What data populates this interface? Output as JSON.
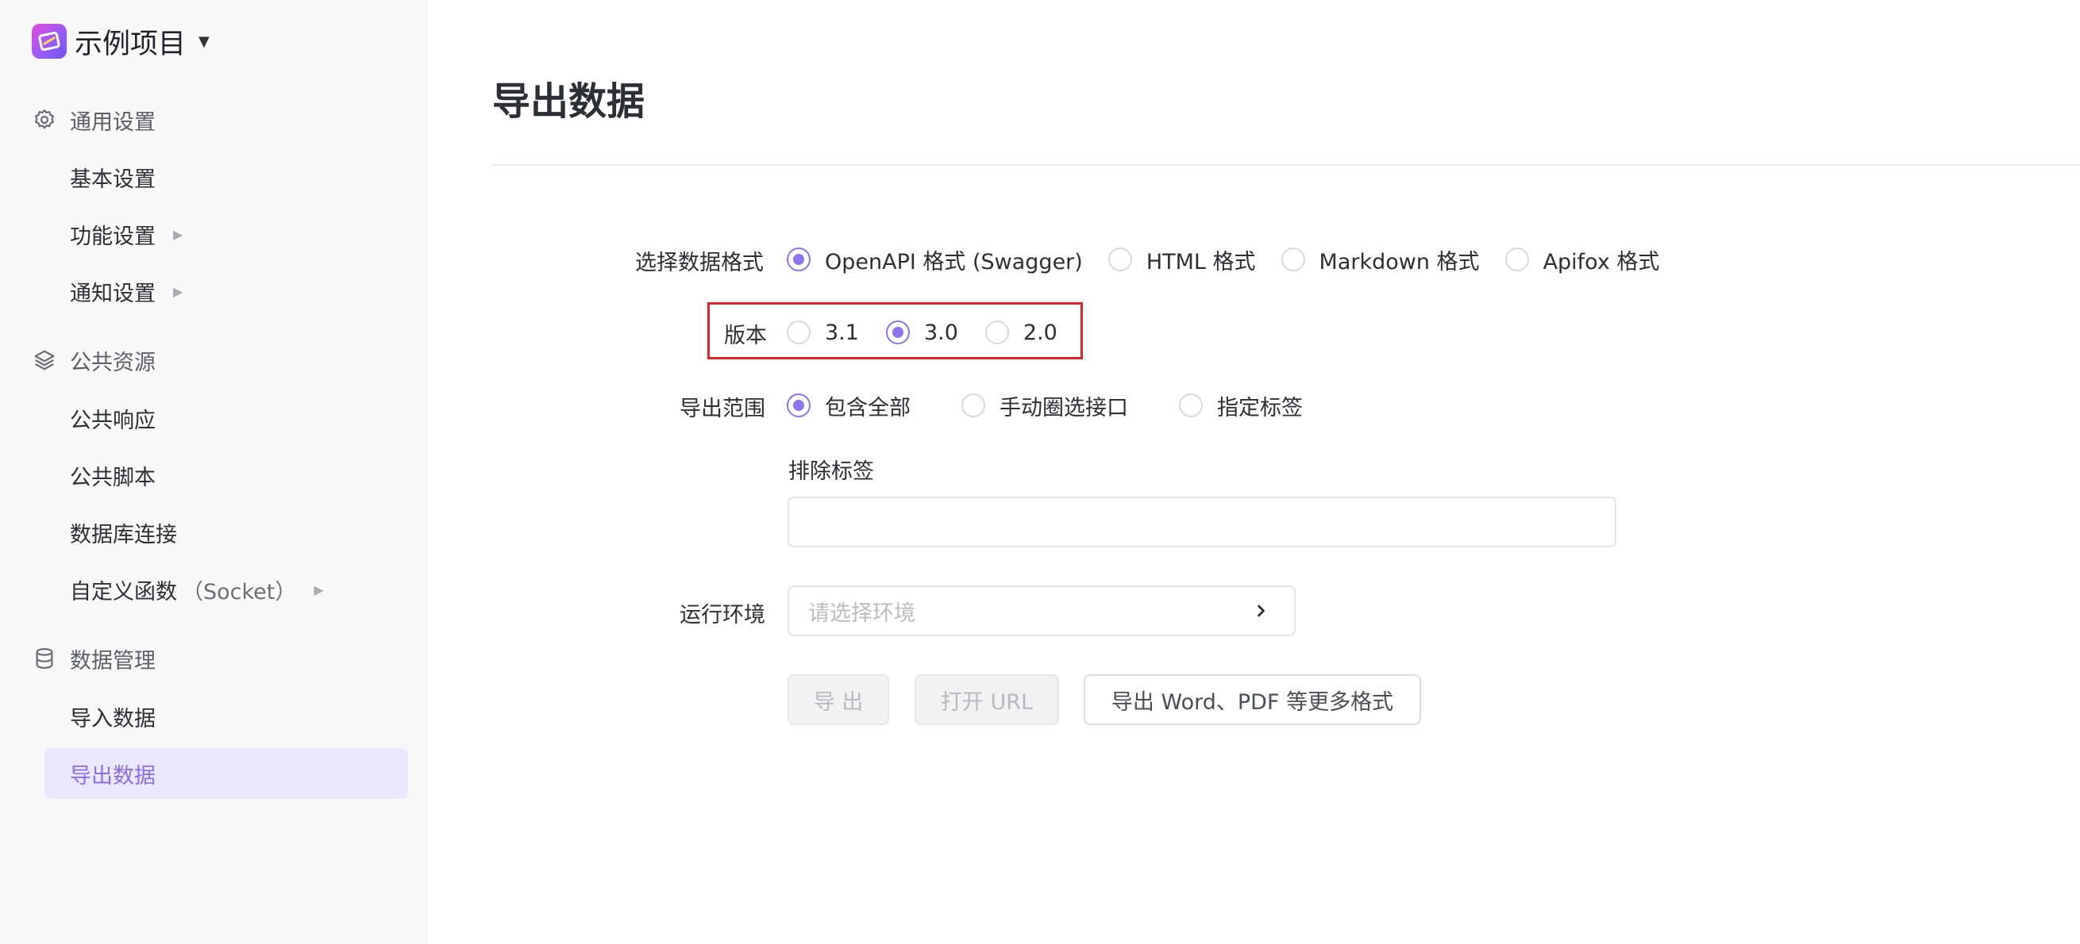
{
  "project": {
    "name": "示例项目",
    "caret": "▼"
  },
  "sidebar": {
    "groups": [
      {
        "label": "通用设置",
        "icon": "gear-icon",
        "items": [
          {
            "label": "基本设置"
          },
          {
            "label": "功能设置",
            "arrow": "▶"
          },
          {
            "label": "通知设置",
            "arrow": "▶"
          }
        ]
      },
      {
        "label": "公共资源",
        "icon": "layers-icon",
        "items": [
          {
            "label": "公共响应"
          },
          {
            "label": "公共脚本"
          },
          {
            "label": "数据库连接"
          },
          {
            "label": "自定义函数",
            "suffix": "（Socket）",
            "arrow": "▶"
          }
        ]
      },
      {
        "label": "数据管理",
        "icon": "database-icon",
        "items": [
          {
            "label": "导入数据"
          },
          {
            "label": "导出数据",
            "active": true
          }
        ]
      }
    ]
  },
  "main": {
    "title": "导出数据",
    "format": {
      "label": "选择数据格式",
      "options": [
        "OpenAPI 格式 (Swagger)",
        "HTML 格式",
        "Markdown 格式",
        "Apifox 格式"
      ],
      "selected": "OpenAPI 格式 (Swagger)"
    },
    "version": {
      "label": "版本",
      "options": [
        "3.1",
        "3.0",
        "2.0"
      ],
      "selected": "3.0"
    },
    "scope": {
      "label": "导出范围",
      "options": [
        "包含全部",
        "手动圈选接口",
        "指定标签"
      ],
      "selected": "包含全部"
    },
    "exclude_tags": {
      "label": "排除标签",
      "value": ""
    },
    "environment": {
      "label": "运行环境",
      "placeholder": "请选择环境"
    },
    "buttons": {
      "export": "导 出",
      "open_url": "打开 URL",
      "more_formats": "导出 Word、PDF 等更多格式"
    }
  },
  "colors": {
    "accent": "#8f73ea",
    "highlight": "#e0232d",
    "active_bg": "#ebe8fd"
  }
}
